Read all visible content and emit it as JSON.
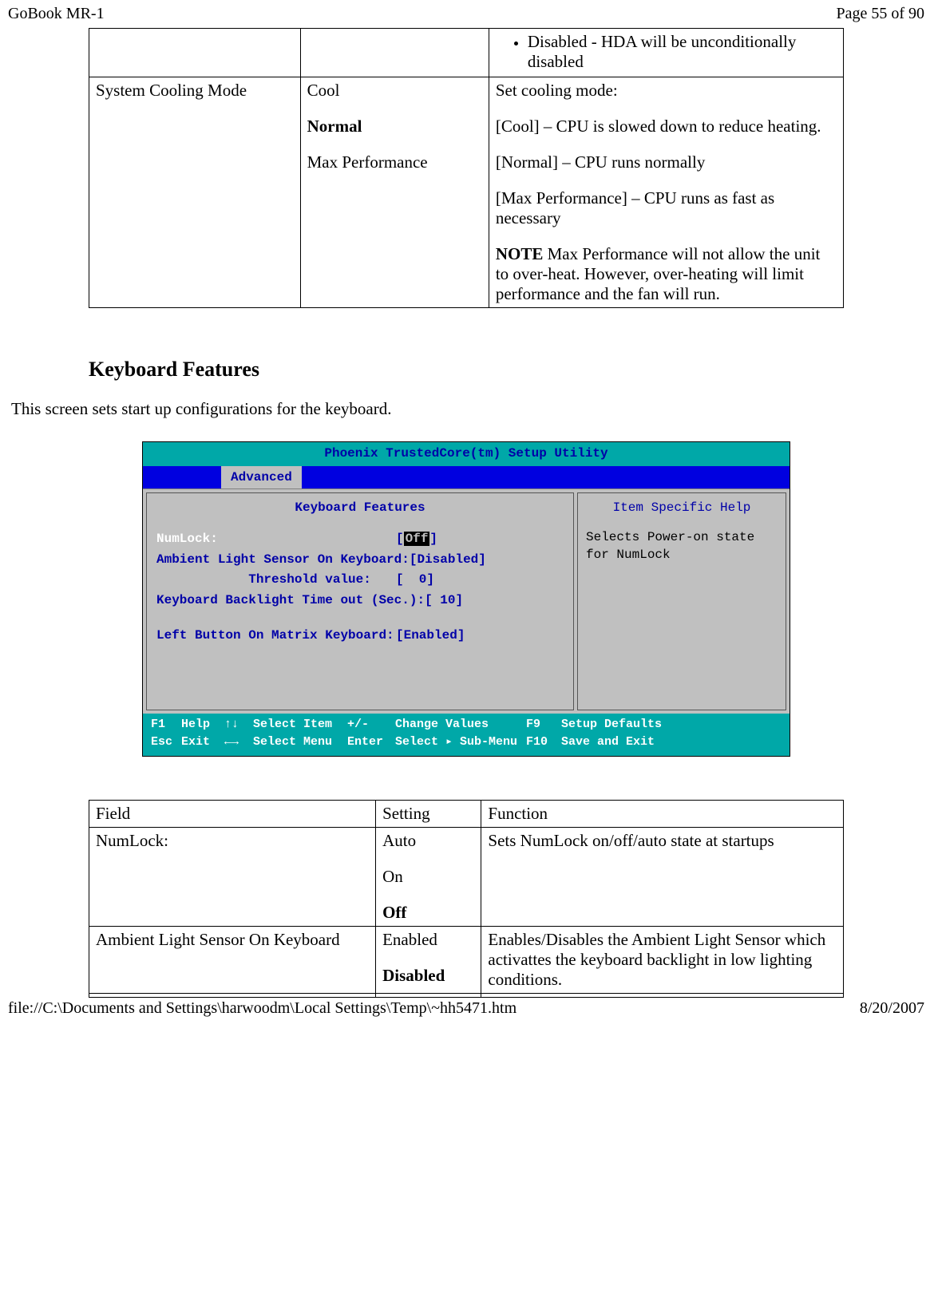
{
  "header": {
    "left": "GoBook MR-1",
    "right": "Page 55 of 90"
  },
  "footer": {
    "left": "file://C:\\Documents and Settings\\harwoodm\\Local Settings\\Temp\\~hh5471.htm",
    "right": "8/20/2007"
  },
  "top_table_row": {
    "bullet": "Disabled - HDA will be unconditionally disabled"
  },
  "cooling_row": {
    "field": "System Cooling Mode",
    "opt1": "Cool",
    "opt2": "Normal",
    "opt3": "Max Performance",
    "f1": "Set cooling mode:",
    "f2": "[Cool] – CPU is slowed down to reduce heating.",
    "f3": "[Normal] – CPU runs normally",
    "f4": "[Max Performance] – CPU runs as fast as necessary",
    "note_label": "NOTE",
    "note_text": " Max Performance will not  allow the unit to over-heat.  However,  over-heating will limit performance and the fan will run."
  },
  "section": {
    "heading": "Keyboard Features",
    "text": "This screen sets start up configurations for the keyboard."
  },
  "bios": {
    "title": "Phoenix TrustedCore(tm) Setup Utility",
    "tab": "Advanced",
    "left_title": "Keyboard Features",
    "right_title": "Item Specific Help",
    "help_text": "Selects Power-on state for NumLock",
    "rows": [
      {
        "label": "NumLock:",
        "prefix": "[",
        "value": "Off",
        "suffix": "]",
        "selected": true
      },
      {
        "label": "Ambient Light Sensor On Keyboard:",
        "prefix": "[",
        "text": "Disabled]",
        "selected": false
      },
      {
        "label": "            Threshold value:",
        "prefix": "[  ",
        "text": "0]",
        "selected": false
      },
      {
        "label": "Keyboard Backlight Time out (Sec.):",
        "prefix": "[ ",
        "text": "10]",
        "selected": false
      },
      {
        "label": "",
        "prefix": "",
        "text": "",
        "selected": false,
        "spacer": true
      },
      {
        "label": "Left Button On Matrix Keyboard:",
        "prefix": "[",
        "text": "Enabled]",
        "selected": false
      }
    ],
    "footer": {
      "r1": [
        "F1",
        "Help",
        "↑↓",
        "Select Item",
        "+/-",
        "Change Values",
        "F9",
        "Setup Defaults"
      ],
      "r2": [
        "Esc",
        "Exit",
        "←→",
        "Select Menu",
        "Enter",
        "Select ▸ Sub-Menu",
        "F10",
        "Save and Exit"
      ]
    }
  },
  "table2": {
    "headers": {
      "field": "Field",
      "setting": "Setting",
      "function": "Function"
    },
    "rows": [
      {
        "field": "NumLock:",
        "settings": [
          "Auto",
          "On",
          "Off"
        ],
        "bold_index": 2,
        "function": "Sets NumLock on/off/auto state at startups"
      },
      {
        "field": "Ambient Light Sensor On Keyboard",
        "settings": [
          "Enabled",
          "Disabled"
        ],
        "bold_index": 1,
        "function": "Enables/Disables the Ambient Light Sensor which activattes the keyboard backlight in low lighting conditions."
      }
    ]
  }
}
